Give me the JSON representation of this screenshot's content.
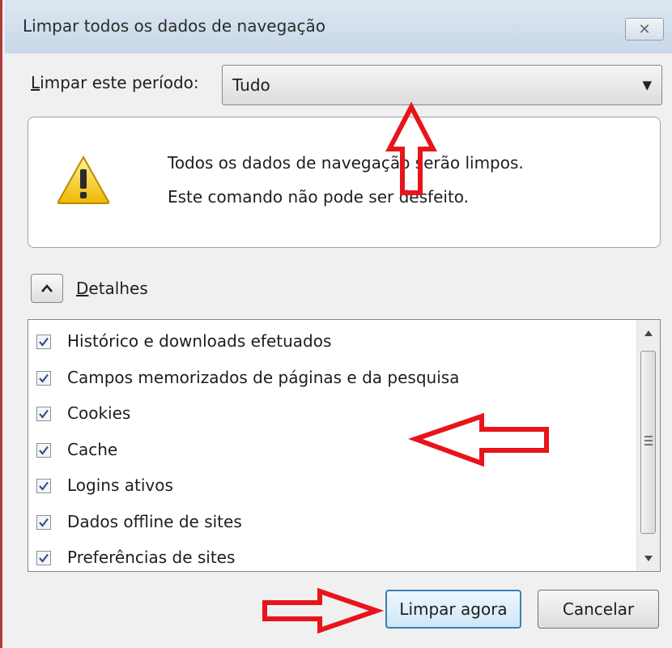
{
  "window": {
    "title": "Limpar todos os dados de navegação",
    "close_glyph": "✕"
  },
  "period": {
    "label_first": "L",
    "label_rest": "impar este período:",
    "selected": "Tudo"
  },
  "warning": {
    "icon": "warning-triangle-icon",
    "line1": "Todos os dados de navegação serão limpos.",
    "line2": "Este comando não pode ser desfeito."
  },
  "details": {
    "label_first": "D",
    "label_rest": "etalhes",
    "expanded": true
  },
  "items": [
    {
      "label": "Histórico e downloads efetuados",
      "checked": true
    },
    {
      "label": "Campos memorizados de páginas e da pesquisa",
      "checked": true
    },
    {
      "label": "Cookies",
      "checked": true
    },
    {
      "label": "Cache",
      "checked": true
    },
    {
      "label": "Logins ativos",
      "checked": true
    },
    {
      "label": "Dados offline de sites",
      "checked": true
    },
    {
      "label": "Preferências de sites",
      "checked": true
    }
  ],
  "buttons": {
    "clear_now": "Limpar agora",
    "cancel": "Cancelar"
  },
  "colors": {
    "annotation_arrow": "#e8141b",
    "warning_fill": "#f5d21f",
    "checkmark": "#3a4f8c"
  }
}
